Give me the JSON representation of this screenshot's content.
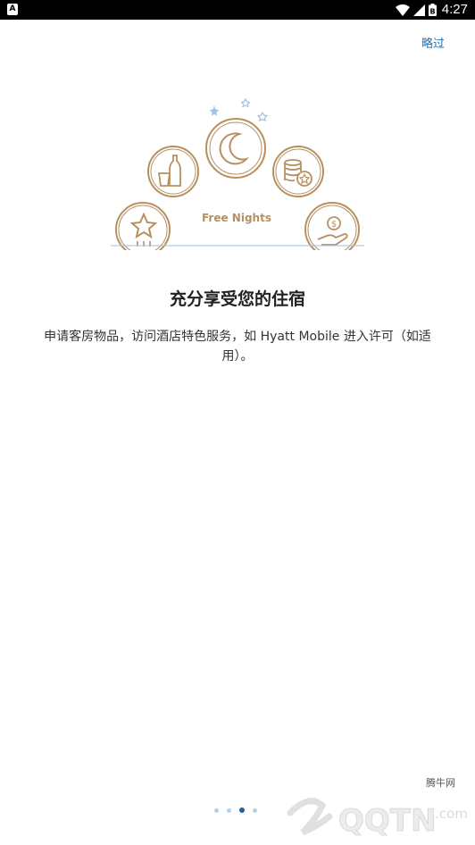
{
  "status_bar": {
    "app_badge": "A",
    "time": "4:27",
    "battery_label": "B"
  },
  "skip_label": "略过",
  "illustration": {
    "caption": "Free Nights",
    "accent_color": "#b89060",
    "star_color": "#9ec2e6"
  },
  "headline": "充分享受您的住宿",
  "description": "申请客房物品，访问酒店特色服务，如 Hyatt Mobile 进入许可（如适用）。",
  "pager": {
    "count": 4,
    "active_index": 2
  },
  "watermark": {
    "brand": "QQTN",
    "domain": ".com",
    "cn_label": "腾牛网"
  }
}
